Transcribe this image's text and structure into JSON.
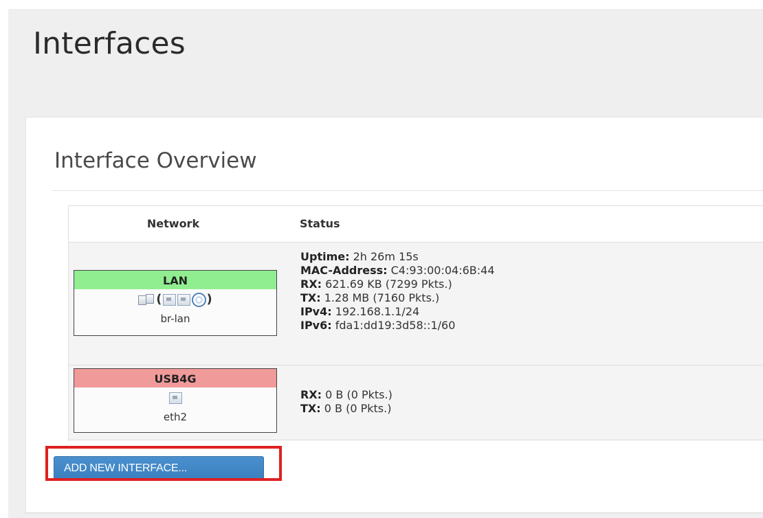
{
  "page": {
    "title": "Interfaces"
  },
  "panel": {
    "title": "Interface Overview"
  },
  "table": {
    "headers": {
      "network": "Network",
      "status": "Status"
    },
    "rows": [
      {
        "name": "LAN",
        "state_color": "#90ee90",
        "device": "br-lan",
        "icons": [
          "bridge-icon",
          "ethernet-icon",
          "ethernet-icon",
          "wifi-icon"
        ],
        "status": [
          {
            "label": "Uptime:",
            "value": "2h 26m 15s"
          },
          {
            "label": "MAC-Address:",
            "value": "C4:93:00:04:6B:44"
          },
          {
            "label": "RX:",
            "value": "621.69 KB (7299 Pkts.)"
          },
          {
            "label": "TX:",
            "value": "1.28 MB (7160 Pkts.)"
          },
          {
            "label": "IPv4:",
            "value": "192.168.1.1/24"
          },
          {
            "label": "IPv6:",
            "value": "fda1:dd19:3d58::1/60"
          }
        ]
      },
      {
        "name": "USB4G",
        "state_color": "#f09a9a",
        "device": "eth2",
        "icons": [
          "ethernet-icon"
        ],
        "status": [
          {
            "label": "RX:",
            "value": "0 B (0 Pkts.)"
          },
          {
            "label": "TX:",
            "value": "0 B (0 Pkts.)"
          }
        ]
      }
    ]
  },
  "actions": {
    "add_interface_label": "ADD NEW INTERFACE..."
  },
  "colors": {
    "button": "#3a7fbd",
    "highlight": "#e02020",
    "lan_up": "#90ee90",
    "usb_down": "#f09a9a"
  }
}
